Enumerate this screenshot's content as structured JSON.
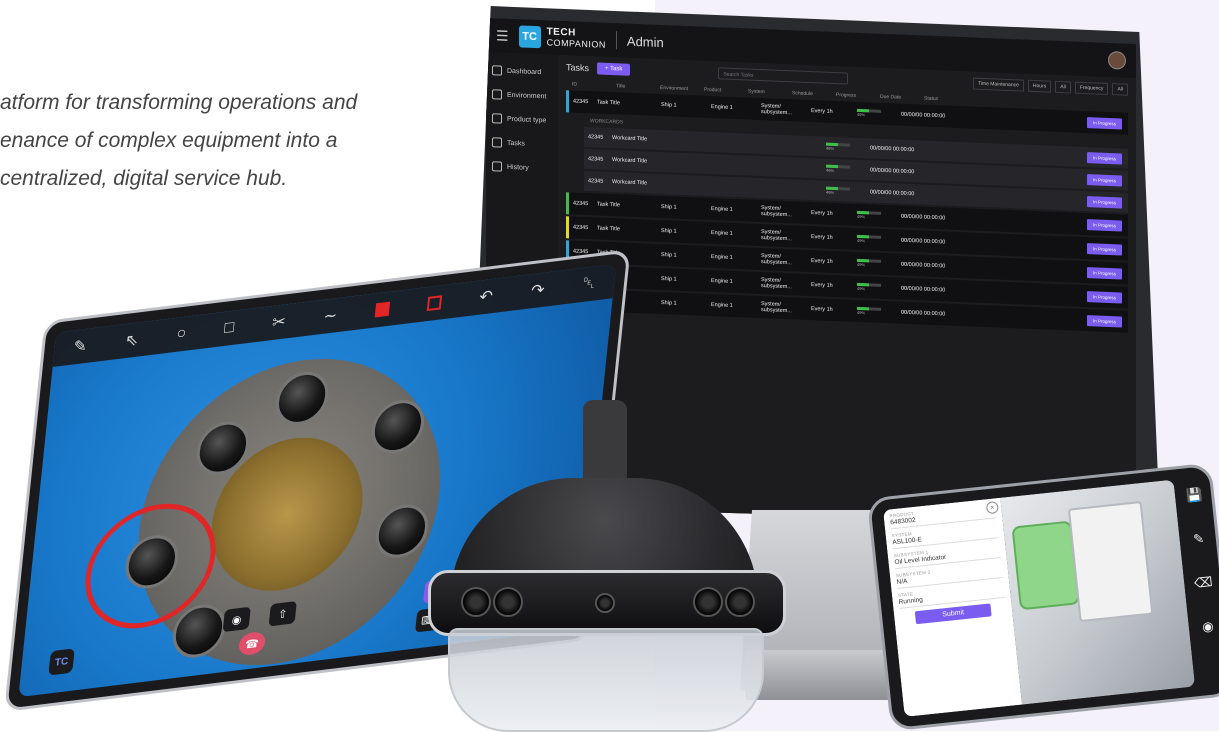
{
  "tagline": [
    "atform for transforming operations and",
    "enance of complex equipment into a",
    "centralized, digital service hub."
  ],
  "dashboard": {
    "brand_top": "TECH",
    "brand_bottom": "COMPANION",
    "section": "Admin",
    "nav": [
      {
        "label": "Dashboard",
        "icon": "grid-icon"
      },
      {
        "label": "Environment",
        "icon": "layers-icon"
      },
      {
        "label": "Product type",
        "icon": "product-icon"
      },
      {
        "label": "Tasks",
        "icon": "check-icon"
      },
      {
        "label": "History",
        "icon": "clock-icon"
      }
    ],
    "page_title": "Tasks",
    "add_task_label": "+ Task",
    "search_placeholder": "Search Tasks",
    "filters": [
      "Time Maintenance",
      "Hours",
      "All",
      "Frequency",
      "All"
    ],
    "columns": [
      "ID",
      "Title",
      "Environment",
      "Product",
      "System",
      "Schedule",
      "Progress",
      "Due Date",
      "Status"
    ],
    "workcards_label": "WORKCARDS",
    "workcard_columns": [
      "ID",
      "Title",
      "Progress",
      "Due Date",
      "Status"
    ],
    "rows": [
      {
        "id": "42345",
        "title": "Task Title",
        "env": "Ship 1",
        "product": "Engine 1",
        "system": "System/ subsystem...",
        "schedule": "Every 1h",
        "progress": 0.49,
        "pct": "49%",
        "due": "00/00/00 00:00:00",
        "status": "In Progress",
        "color": "#29a8e0"
      },
      {
        "id": "42345",
        "title": "Task Title",
        "env": "Ship 1",
        "product": "Engine 1",
        "system": "System/ subsystem...",
        "schedule": "Every 1h",
        "progress": 0.49,
        "pct": "49%",
        "due": "00/00/00 00:00:00",
        "status": "In Progress",
        "color": "#3fbf4a"
      },
      {
        "id": "42345",
        "title": "Task Title",
        "env": "Ship 1",
        "product": "Engine 1",
        "system": "System/ subsystem...",
        "schedule": "Every 1h",
        "progress": 0.49,
        "pct": "49%",
        "due": "00/00/00 00:00:00",
        "status": "In Progress",
        "color": "#e3d92a"
      },
      {
        "id": "42345",
        "title": "Task Title",
        "env": "Ship 1",
        "product": "Engine 1",
        "system": "System/ subsystem...",
        "schedule": "Every 1h",
        "progress": 0.49,
        "pct": "49%",
        "due": "00/00/00 00:00:00",
        "status": "In Progress",
        "color": "#29a8e0"
      },
      {
        "id": "42345",
        "title": "Task Title",
        "env": "Ship 1",
        "product": "Engine 1",
        "system": "System/ subsystem...",
        "schedule": "Every 1h",
        "progress": 0.49,
        "pct": "49%",
        "due": "00/00/00 00:00:00",
        "status": "In Progress",
        "color": "#d63bb8"
      },
      {
        "id": "42345",
        "title": "Task Title",
        "env": "Ship 1",
        "product": "Engine 1",
        "system": "System/ subsystem...",
        "schedule": "Every 1h",
        "progress": 0.49,
        "pct": "49%",
        "due": "00/00/00 00:00:00",
        "status": "In Progress",
        "color": "#3fbf4a"
      }
    ],
    "workcards": [
      {
        "id": "42345",
        "title": "Workcard Title",
        "progress": 0.49,
        "pct": "49%",
        "due": "00/00/00 00:00:00",
        "status": "In Progress"
      },
      {
        "id": "42345",
        "title": "Workcard Title",
        "progress": 0.49,
        "pct": "49%",
        "due": "00/00/00 00:00:00",
        "status": "In Progress"
      },
      {
        "id": "42345",
        "title": "Workcard Title",
        "progress": 0.49,
        "pct": "49%",
        "due": "00/00/00 00:00:00",
        "status": "In Progress"
      }
    ]
  },
  "tablet": {
    "tools": [
      "pen-icon",
      "select-icon",
      "circle-icon",
      "square-icon",
      "scissors-icon",
      "wave-icon",
      "red-fill-swatch",
      "red-outline-swatch",
      "undo-icon",
      "redo-icon",
      "trash-icon"
    ],
    "badge": "TC"
  },
  "phone": {
    "fields": [
      {
        "label": "PRODUCT",
        "value": "6483002"
      },
      {
        "label": "SYSTEM",
        "value": "ASL100-E"
      },
      {
        "label": "SUBSYSTEM 1",
        "value": "Oil Level Indicator"
      },
      {
        "label": "SUBSYSTEM 2",
        "value": "N/A"
      },
      {
        "label": "STATE",
        "value": "Running"
      }
    ],
    "submit_label": "Submit"
  }
}
